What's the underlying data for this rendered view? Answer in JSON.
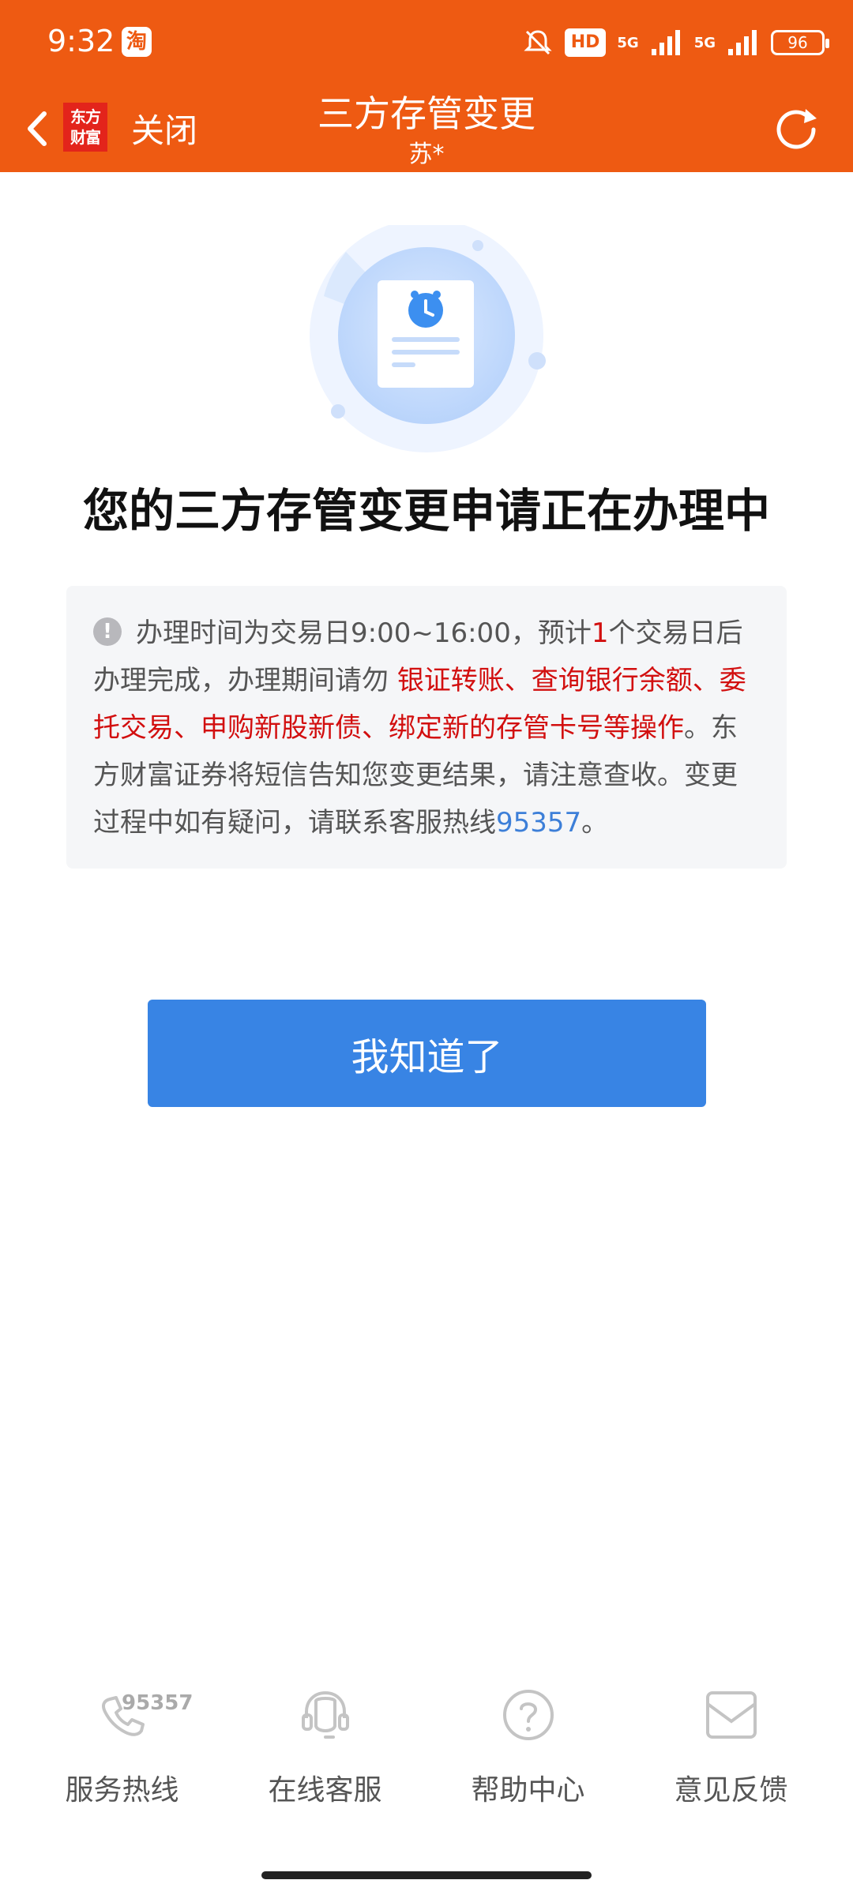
{
  "status_bar": {
    "time": "9:32",
    "taobao_badge": "淘",
    "hd": "HD",
    "net1": "5G",
    "net2": "5G",
    "battery": "96"
  },
  "nav": {
    "logo_line1": "东方",
    "logo_line2": "财富",
    "close_label": "关闭",
    "title": "三方存管变更",
    "subtitle": "苏*"
  },
  "main": {
    "headline": "您的三方存管变更申请正在办理中",
    "notice": {
      "icon": "!",
      "t1": "办理时间为交易日9:00~16:00，预计",
      "t2": "1",
      "t3": "个交易日后办理完成，办理期间请勿 ",
      "t4": "银证转账、查询银行余额、委托交易、申购新股新债、绑定新的存管卡号等操作",
      "t5": "。东方财富证券将短信告知您变更结果，请注意查收。变更过程中如有疑问，请联系客服热线",
      "t6": "95357",
      "t7": "。"
    },
    "ok_button": "我知道了"
  },
  "bottom_bar": {
    "items": [
      {
        "label": "服务热线",
        "icon": "phone-icon",
        "badge": "95357"
      },
      {
        "label": "在线客服",
        "icon": "headset-icon"
      },
      {
        "label": "帮助中心",
        "icon": "question-icon"
      },
      {
        "label": "意见反馈",
        "icon": "mail-icon"
      }
    ]
  },
  "colors": {
    "brand_orange": "#ee5a12",
    "button_blue": "#3884e4",
    "warning_red": "#d20f0f",
    "link_blue": "#3d7fd8"
  }
}
